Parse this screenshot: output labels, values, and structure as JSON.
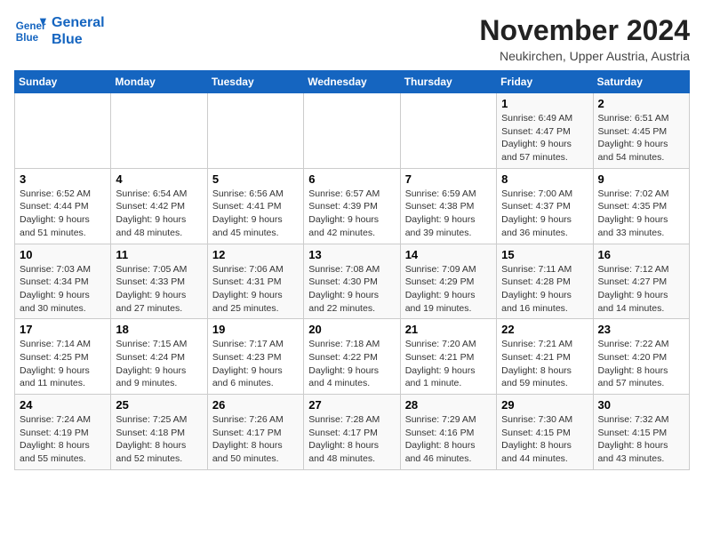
{
  "header": {
    "logo_line1": "General",
    "logo_line2": "Blue",
    "month_title": "November 2024",
    "location": "Neukirchen, Upper Austria, Austria"
  },
  "weekdays": [
    "Sunday",
    "Monday",
    "Tuesday",
    "Wednesday",
    "Thursday",
    "Friday",
    "Saturday"
  ],
  "weeks": [
    [
      {
        "day": "",
        "info": ""
      },
      {
        "day": "",
        "info": ""
      },
      {
        "day": "",
        "info": ""
      },
      {
        "day": "",
        "info": ""
      },
      {
        "day": "",
        "info": ""
      },
      {
        "day": "1",
        "info": "Sunrise: 6:49 AM\nSunset: 4:47 PM\nDaylight: 9 hours\nand 57 minutes."
      },
      {
        "day": "2",
        "info": "Sunrise: 6:51 AM\nSunset: 4:45 PM\nDaylight: 9 hours\nand 54 minutes."
      }
    ],
    [
      {
        "day": "3",
        "info": "Sunrise: 6:52 AM\nSunset: 4:44 PM\nDaylight: 9 hours\nand 51 minutes."
      },
      {
        "day": "4",
        "info": "Sunrise: 6:54 AM\nSunset: 4:42 PM\nDaylight: 9 hours\nand 48 minutes."
      },
      {
        "day": "5",
        "info": "Sunrise: 6:56 AM\nSunset: 4:41 PM\nDaylight: 9 hours\nand 45 minutes."
      },
      {
        "day": "6",
        "info": "Sunrise: 6:57 AM\nSunset: 4:39 PM\nDaylight: 9 hours\nand 42 minutes."
      },
      {
        "day": "7",
        "info": "Sunrise: 6:59 AM\nSunset: 4:38 PM\nDaylight: 9 hours\nand 39 minutes."
      },
      {
        "day": "8",
        "info": "Sunrise: 7:00 AM\nSunset: 4:37 PM\nDaylight: 9 hours\nand 36 minutes."
      },
      {
        "day": "9",
        "info": "Sunrise: 7:02 AM\nSunset: 4:35 PM\nDaylight: 9 hours\nand 33 minutes."
      }
    ],
    [
      {
        "day": "10",
        "info": "Sunrise: 7:03 AM\nSunset: 4:34 PM\nDaylight: 9 hours\nand 30 minutes."
      },
      {
        "day": "11",
        "info": "Sunrise: 7:05 AM\nSunset: 4:33 PM\nDaylight: 9 hours\nand 27 minutes."
      },
      {
        "day": "12",
        "info": "Sunrise: 7:06 AM\nSunset: 4:31 PM\nDaylight: 9 hours\nand 25 minutes."
      },
      {
        "day": "13",
        "info": "Sunrise: 7:08 AM\nSunset: 4:30 PM\nDaylight: 9 hours\nand 22 minutes."
      },
      {
        "day": "14",
        "info": "Sunrise: 7:09 AM\nSunset: 4:29 PM\nDaylight: 9 hours\nand 19 minutes."
      },
      {
        "day": "15",
        "info": "Sunrise: 7:11 AM\nSunset: 4:28 PM\nDaylight: 9 hours\nand 16 minutes."
      },
      {
        "day": "16",
        "info": "Sunrise: 7:12 AM\nSunset: 4:27 PM\nDaylight: 9 hours\nand 14 minutes."
      }
    ],
    [
      {
        "day": "17",
        "info": "Sunrise: 7:14 AM\nSunset: 4:25 PM\nDaylight: 9 hours\nand 11 minutes."
      },
      {
        "day": "18",
        "info": "Sunrise: 7:15 AM\nSunset: 4:24 PM\nDaylight: 9 hours\nand 9 minutes."
      },
      {
        "day": "19",
        "info": "Sunrise: 7:17 AM\nSunset: 4:23 PM\nDaylight: 9 hours\nand 6 minutes."
      },
      {
        "day": "20",
        "info": "Sunrise: 7:18 AM\nSunset: 4:22 PM\nDaylight: 9 hours\nand 4 minutes."
      },
      {
        "day": "21",
        "info": "Sunrise: 7:20 AM\nSunset: 4:21 PM\nDaylight: 9 hours\nand 1 minute."
      },
      {
        "day": "22",
        "info": "Sunrise: 7:21 AM\nSunset: 4:21 PM\nDaylight: 8 hours\nand 59 minutes."
      },
      {
        "day": "23",
        "info": "Sunrise: 7:22 AM\nSunset: 4:20 PM\nDaylight: 8 hours\nand 57 minutes."
      }
    ],
    [
      {
        "day": "24",
        "info": "Sunrise: 7:24 AM\nSunset: 4:19 PM\nDaylight: 8 hours\nand 55 minutes."
      },
      {
        "day": "25",
        "info": "Sunrise: 7:25 AM\nSunset: 4:18 PM\nDaylight: 8 hours\nand 52 minutes."
      },
      {
        "day": "26",
        "info": "Sunrise: 7:26 AM\nSunset: 4:17 PM\nDaylight: 8 hours\nand 50 minutes."
      },
      {
        "day": "27",
        "info": "Sunrise: 7:28 AM\nSunset: 4:17 PM\nDaylight: 8 hours\nand 48 minutes."
      },
      {
        "day": "28",
        "info": "Sunrise: 7:29 AM\nSunset: 4:16 PM\nDaylight: 8 hours\nand 46 minutes."
      },
      {
        "day": "29",
        "info": "Sunrise: 7:30 AM\nSunset: 4:15 PM\nDaylight: 8 hours\nand 44 minutes."
      },
      {
        "day": "30",
        "info": "Sunrise: 7:32 AM\nSunset: 4:15 PM\nDaylight: 8 hours\nand 43 minutes."
      }
    ]
  ]
}
